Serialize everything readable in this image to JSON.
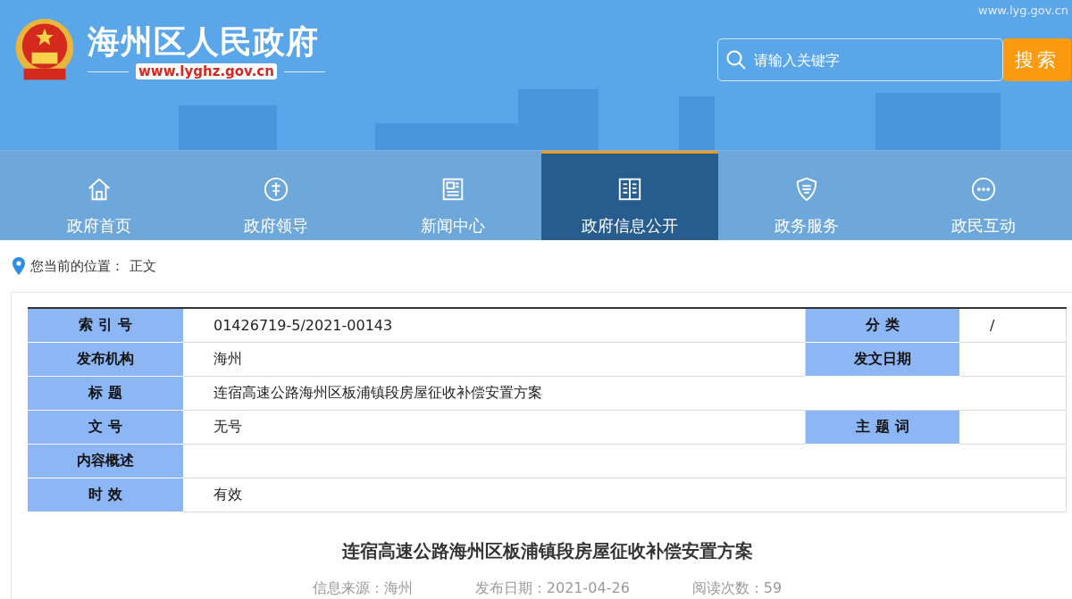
{
  "header": {
    "site_name": "海州区人民政府",
    "site_url": "www.lyghz.gov.cn",
    "corner_url": "www.lyg.gov.cn",
    "search": {
      "placeholder": "请输入关键字",
      "button": "搜索"
    }
  },
  "nav": [
    {
      "label": "政府首页",
      "kind": "home",
      "selected": false
    },
    {
      "label": "政府领导",
      "kind": "leader",
      "selected": false
    },
    {
      "label": "新闻中心",
      "kind": "news",
      "selected": false
    },
    {
      "label": "政府信息公开",
      "kind": "book",
      "selected": true
    },
    {
      "label": "政务服务",
      "kind": "shield",
      "selected": false
    },
    {
      "label": "政民互动",
      "kind": "chat",
      "selected": false
    }
  ],
  "breadcrumb": {
    "label": "您当前的位置：",
    "current": "正文"
  },
  "info_table": [
    {
      "label": "索 引 号",
      "value": "01426719-5/2021-00143",
      "label_2": "分 类",
      "value_2": "/"
    },
    {
      "label": "发布机构",
      "value": "海州",
      "label_2": "发文日期"
    },
    {
      "label": "标 题",
      "value": "连宿高速公路海州区板浦镇段房屋征收补偿安置方案"
    },
    {
      "label": "文 号",
      "value": "无号",
      "label_2": "主 题 词"
    },
    {
      "label": "内容概述"
    },
    {
      "label": "时 效",
      "value": "有效"
    }
  ],
  "article": {
    "title": "连宿高速公路海州区板浦镇段房屋征收补偿安置方案",
    "source": "信息来源：海州",
    "date": "发布日期：2021-04-26",
    "views": "阅读次数：59"
  }
}
